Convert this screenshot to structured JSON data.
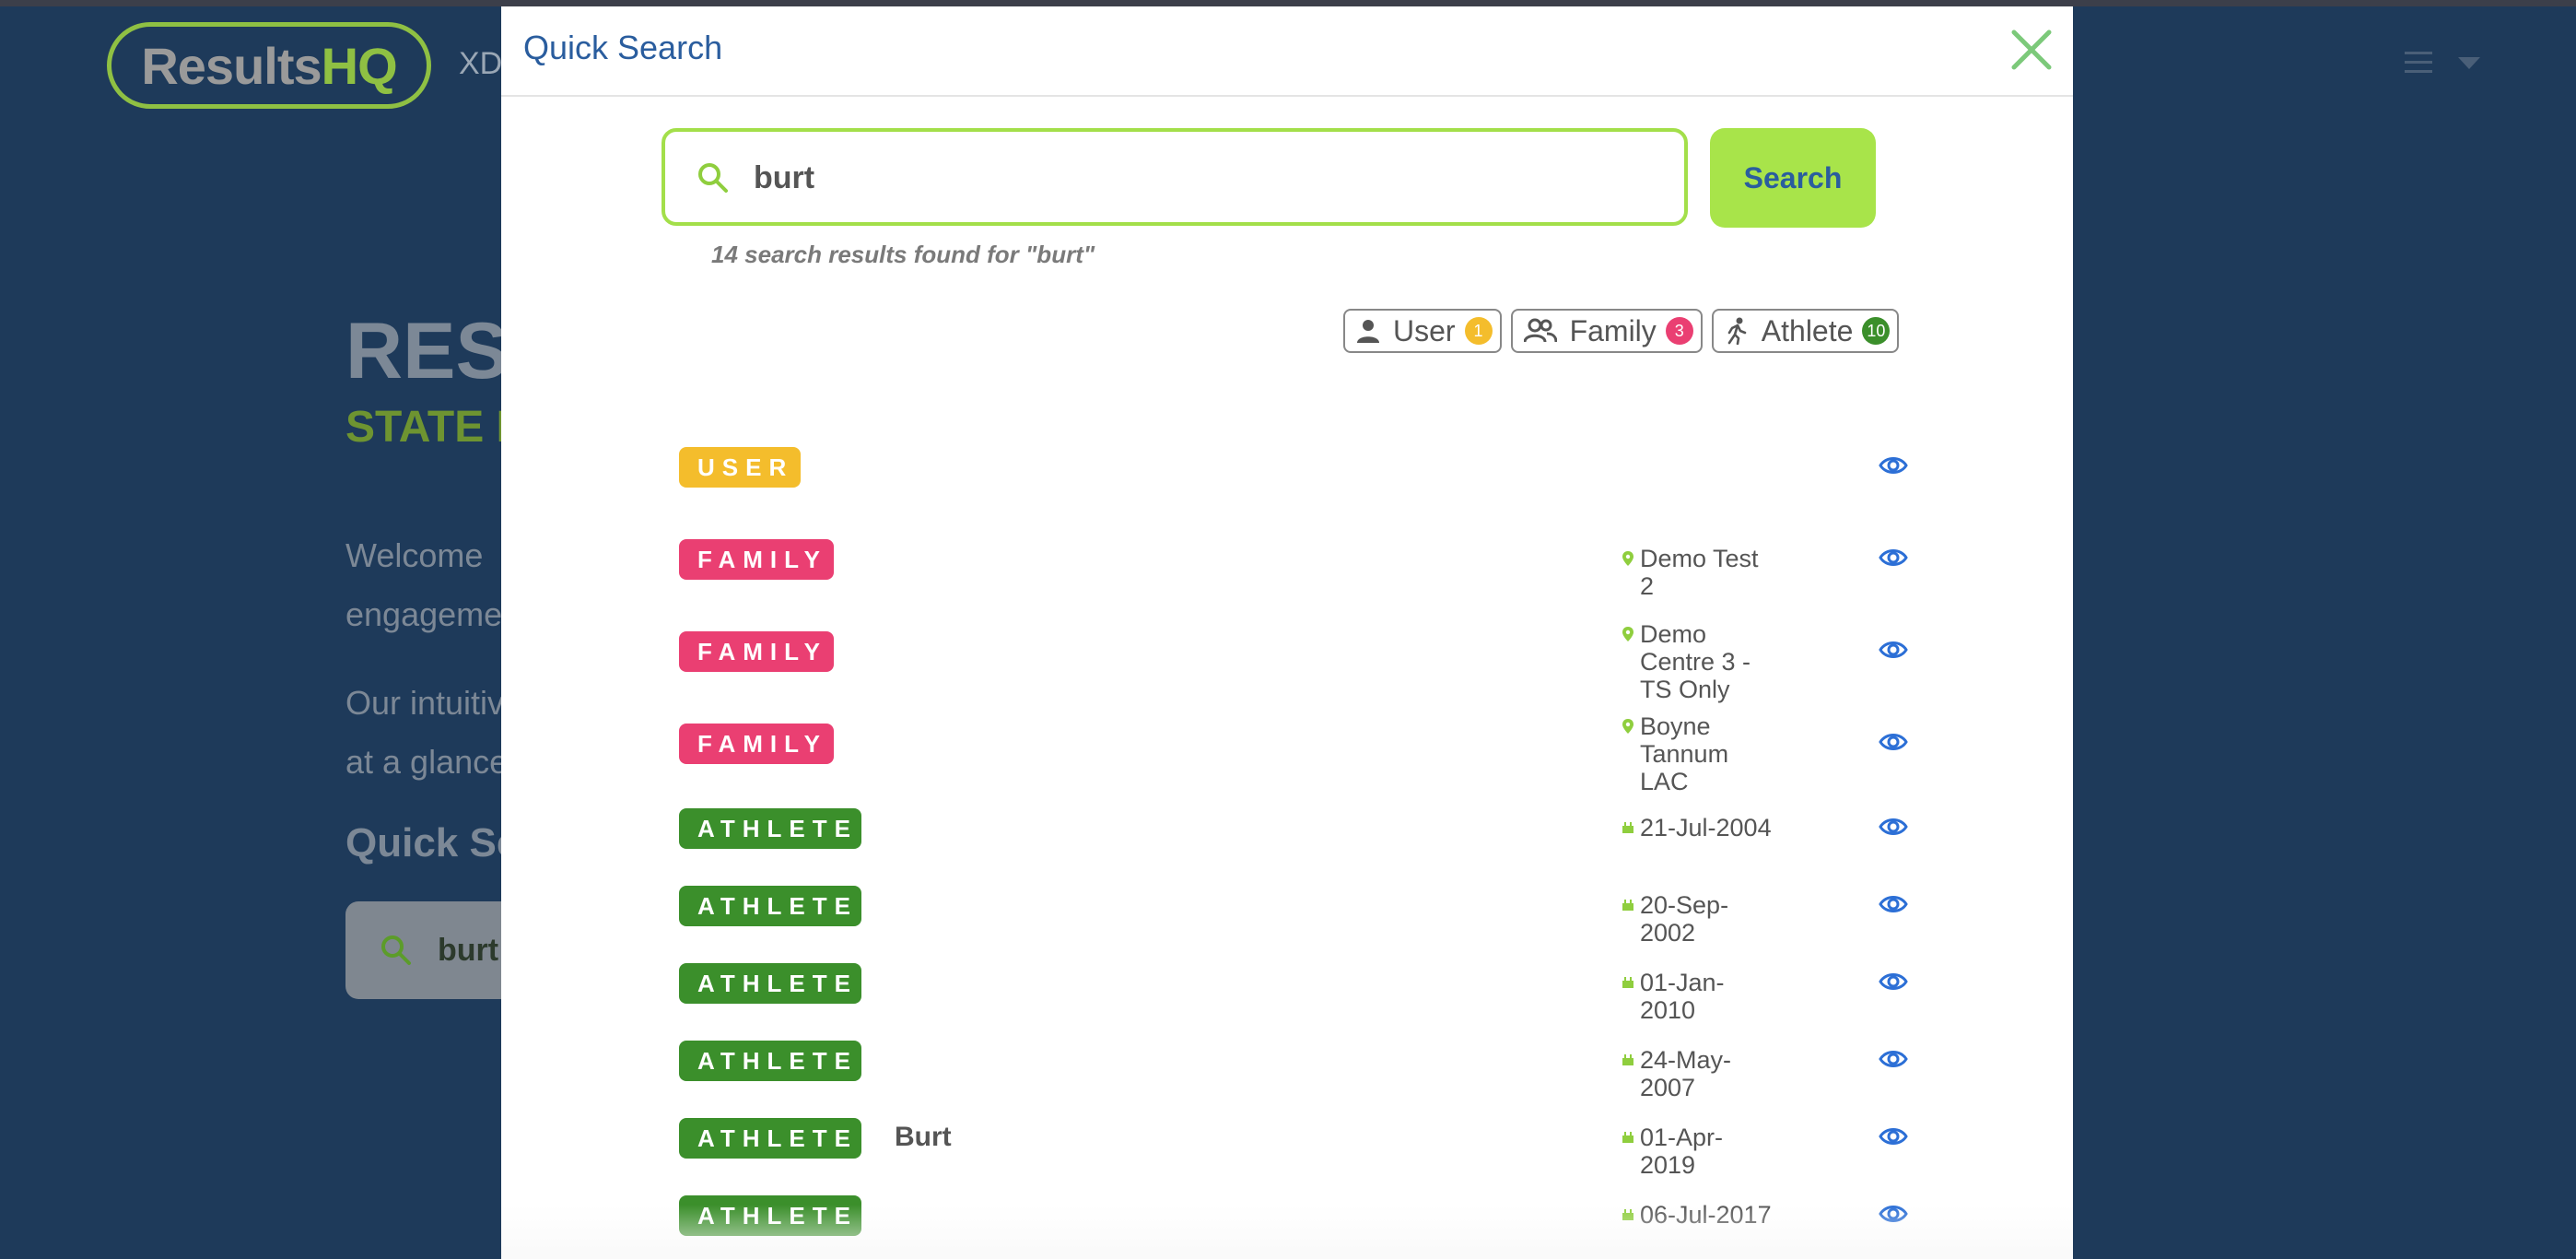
{
  "background": {
    "logo": {
      "main": "Results",
      "accent": "HQ"
    },
    "nav_text": "XD",
    "hero_title": "RESU",
    "hero_subtitle": "STATE I",
    "para1_line1": "Welcome",
    "para1_line2": "engageme",
    "para2_line1": "Our  intuitiv",
    "para2_line2": "at a glance",
    "quick_search_heading": "Quick Se",
    "search_value": "burt"
  },
  "modal": {
    "title": "Quick Search",
    "search": {
      "value": "burt",
      "placeholder": "",
      "button_label": "Search"
    },
    "result_summary": "14 search results found for \"burt\"",
    "filters": [
      {
        "label": "User",
        "count": "1",
        "color": "#f4bd2c",
        "icon": "person-icon"
      },
      {
        "label": "Family",
        "count": "3",
        "color": "#ea3f72",
        "icon": "people-icon"
      },
      {
        "label": "Athlete",
        "count": "10",
        "color": "#3b8f2b",
        "icon": "runner-icon"
      }
    ],
    "results": [
      {
        "type": "USER",
        "name": "",
        "meta": "",
        "meta_icon": ""
      },
      {
        "type": "FAMILY",
        "name": "",
        "meta": "Demo Test 2",
        "meta_icon": "location-pin-icon"
      },
      {
        "type": "FAMILY",
        "name": "",
        "meta": "Demo Centre 3 - TS Only",
        "meta_icon": "location-pin-icon"
      },
      {
        "type": "FAMILY",
        "name": "",
        "meta": "Boyne Tannum LAC",
        "meta_icon": "location-pin-icon"
      },
      {
        "type": "ATHLETE",
        "name": "",
        "meta": "21-Jul-2004",
        "meta_icon": "cake-icon"
      },
      {
        "type": "ATHLETE",
        "name": "",
        "meta": "20-Sep-2002",
        "meta_icon": "cake-icon"
      },
      {
        "type": "ATHLETE",
        "name": "",
        "meta": "01-Jan-2010",
        "meta_icon": "cake-icon"
      },
      {
        "type": "ATHLETE",
        "name": "",
        "meta": "24-May-2007",
        "meta_icon": "cake-icon"
      },
      {
        "type": "ATHLETE",
        "name": "Burt",
        "meta": "01-Apr-2019",
        "meta_icon": "cake-icon"
      },
      {
        "type": "ATHLETE",
        "name": "",
        "meta": "06-Jul-2017",
        "meta_icon": "cake-icon"
      }
    ]
  },
  "colors": {
    "accent_green": "#a8e44a",
    "title_blue": "#2a5d9e",
    "eye_blue": "#2c6fd6"
  }
}
